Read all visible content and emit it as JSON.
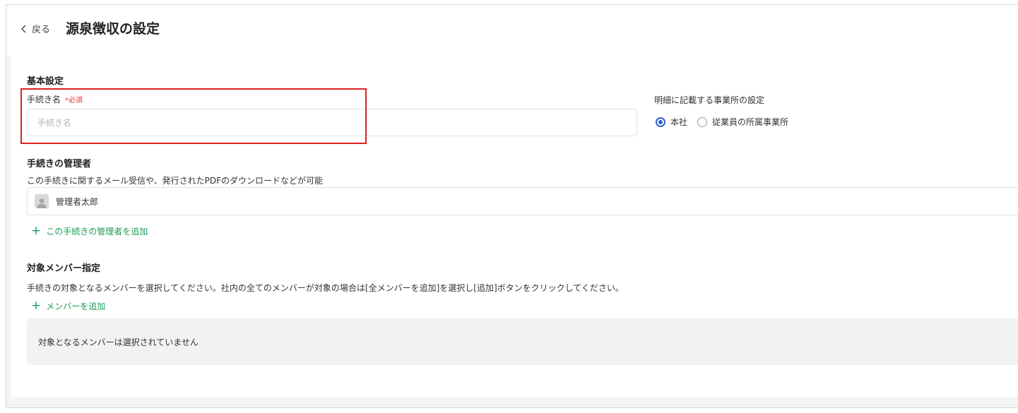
{
  "header": {
    "back_label": "戻る",
    "title": "源泉徴収の設定"
  },
  "basic": {
    "section_title": "基本設定",
    "procedure_name_label": "手続き名",
    "required_label": "*必須",
    "procedure_name_value": "",
    "procedure_name_placeholder": "手続き名",
    "office_label": "明細に記載する事業所の設定",
    "office_options": [
      {
        "label": "本社",
        "selected": true
      },
      {
        "label": "従業員の所属事業所",
        "selected": false
      }
    ]
  },
  "admin": {
    "section_title": "手続きの管理者",
    "description": "この手続きに関するメール受信や、発行されたPDFのダウンロードなどが可能",
    "admin_name": "管理者太郎",
    "avatar_icon": "user-silhouette-icon",
    "add_label": "この手続きの管理者を追加"
  },
  "members": {
    "section_title": "対象メンバー指定",
    "description": "手続きの対象となるメンバーを選択してください。社内の全てのメンバーが対象の場合は[全メンバーを追加]を選択し[追加]ボタンをクリックしてください。",
    "add_label": "メンバーを追加",
    "empty_message": "対象となるメンバーは選択されていません"
  },
  "colors": {
    "accent_green": "#1a9c55",
    "radio_blue": "#2e63c9",
    "required_red": "#e0323c",
    "highlight_red": "#e01f1f"
  }
}
